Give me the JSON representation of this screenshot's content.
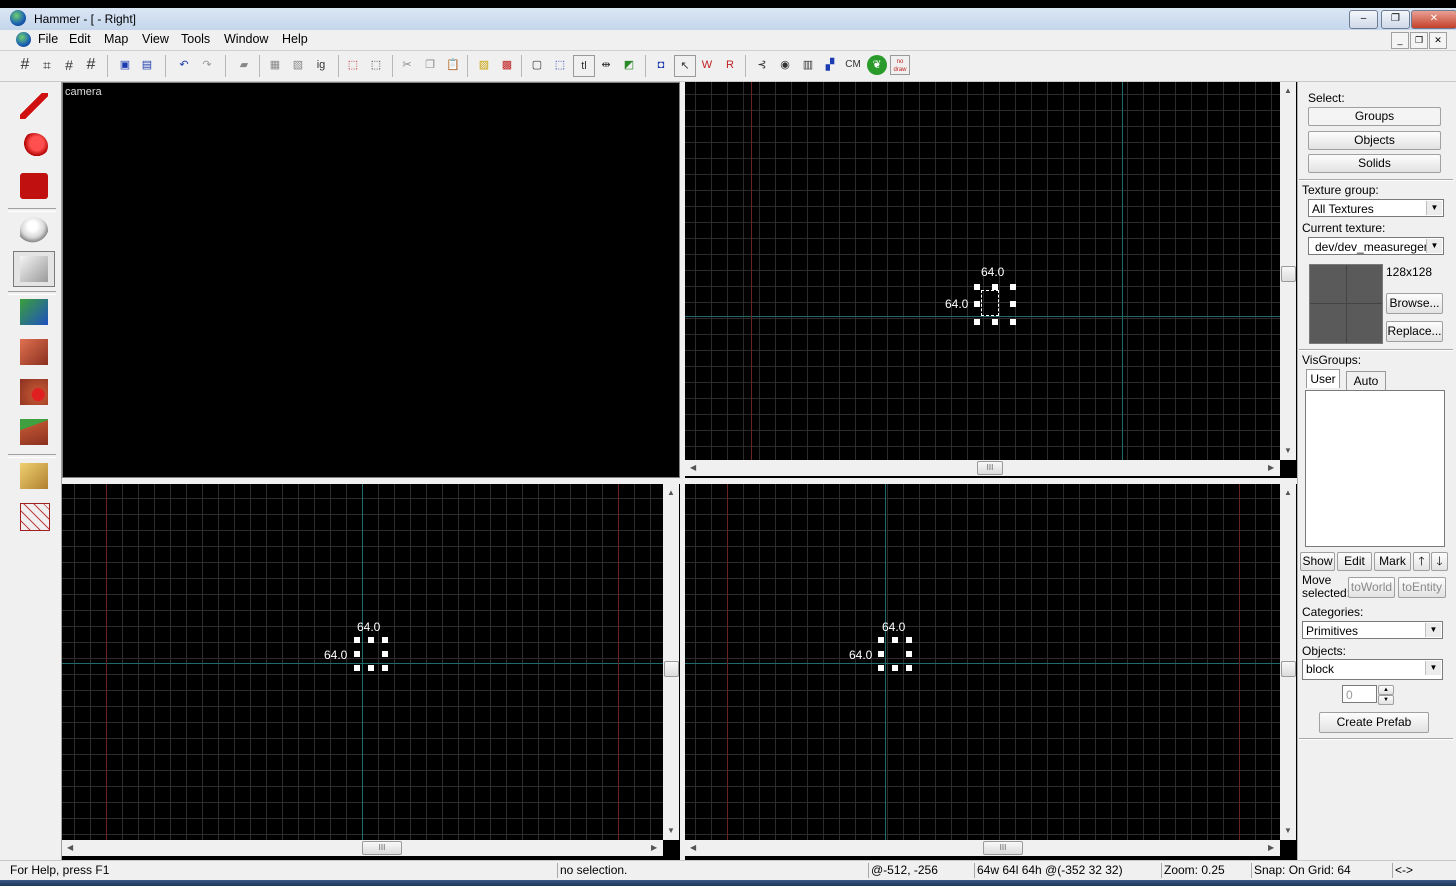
{
  "window": {
    "title": "Hammer - [ - Right]"
  },
  "caption_buttons": {
    "minimize": "–",
    "maximize": "❐",
    "close": "✕"
  },
  "menu": [
    "File",
    "Edit",
    "Map",
    "View",
    "Tools",
    "Window",
    "Help"
  ],
  "mdi_buttons": {
    "minimize": "_",
    "restore": "❐",
    "close": "✕"
  },
  "toolbar": {
    "ig_label": "ig",
    "tl_label": "tl",
    "cm_label": "CM",
    "nodraw_label": "no draw"
  },
  "viewports": {
    "camera_label": "camera",
    "top_right": {
      "dim_w": "64.0",
      "dim_h": "64.0"
    },
    "bottom_left": {
      "dim_w": "64.0",
      "dim_h": "64.0"
    },
    "bottom_right": {
      "dim_w": "64.0",
      "dim_h": "64.0"
    }
  },
  "scroll_glyphs": {
    "up": "▲",
    "down": "▼",
    "left": "◀",
    "right": "▶",
    "grip": "III"
  },
  "right_panel": {
    "select_label": "Select:",
    "groups": "Groups",
    "objects": "Objects",
    "solids": "Solids",
    "texture_group_label": "Texture group:",
    "texture_group_value": "All Textures",
    "current_texture_label": "Current texture:",
    "current_texture_value": "dev/dev_measuregene",
    "texture_size": "128x128",
    "browse": "Browse...",
    "replace": "Replace...",
    "visgroups_label": "VisGroups:",
    "tab_user": "User",
    "tab_auto": "Auto",
    "show": "Show",
    "edit": "Edit",
    "mark": "Mark",
    "move_up": "🡑",
    "move_down": "🡓",
    "move_selected": "Move selected:",
    "to_world": "toWorld",
    "to_entity": "toEntity",
    "categories_label": "Categories:",
    "categories_value": "Primitives",
    "objects_label": "Objects:",
    "objects_value": "block",
    "spin_value": "0",
    "create_prefab": "Create Prefab"
  },
  "combo_arrow": "▼",
  "status": {
    "help": "For Help, press F1",
    "selection": "no selection.",
    "coords": "@-512, -256",
    "size": "64w 64l 64h @(-352 32 32)",
    "zoom": "Zoom: 0.25",
    "snap": "Snap: On Grid: 64",
    "extra": "<->"
  }
}
